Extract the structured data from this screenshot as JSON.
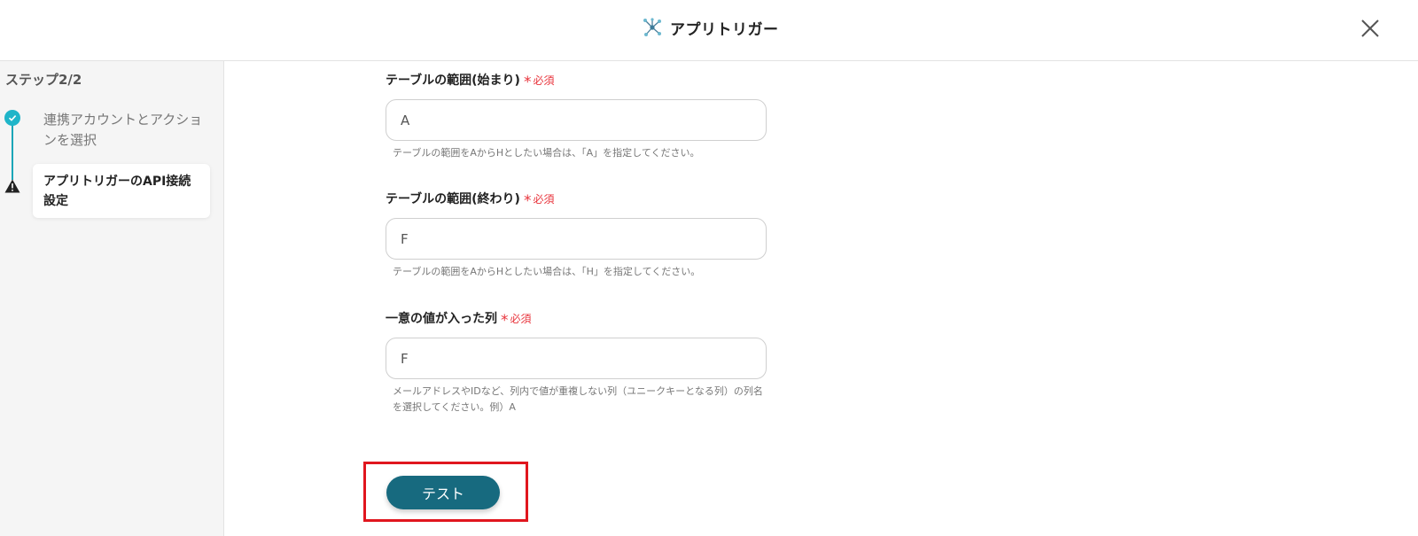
{
  "header": {
    "title": "アプリトリガー",
    "icon": "network-nodes-icon"
  },
  "sidebar": {
    "step_label": "ステップ2/2",
    "steps": [
      {
        "label": "連携アカウントとアクションを選択",
        "status": "done"
      },
      {
        "label": "アプリトリガーのAPI接続設定",
        "status": "warning"
      }
    ]
  },
  "form": {
    "required_text": "必須",
    "fields": [
      {
        "label": "テーブルの範囲(始まり)",
        "value": "A",
        "help": "テーブルの範囲をAからHとしたい場合は、「A」を指定してください。"
      },
      {
        "label": "テーブルの範囲(終わり)",
        "value": "F",
        "help": "テーブルの範囲をAからHとしたい場合は、「H」を指定してください。"
      },
      {
        "label": "一意の値が入った列",
        "value": "F",
        "help": "メールアドレスやIDなど、列内で値が重複しない列（ユニークキーとなる列）の列名を選択してください。例）A"
      }
    ],
    "test_button": "テスト"
  },
  "colors": {
    "accent": "#176a7f",
    "step_done": "#1fb5c9",
    "required": "#e8343c",
    "highlight": "#e0161e"
  }
}
